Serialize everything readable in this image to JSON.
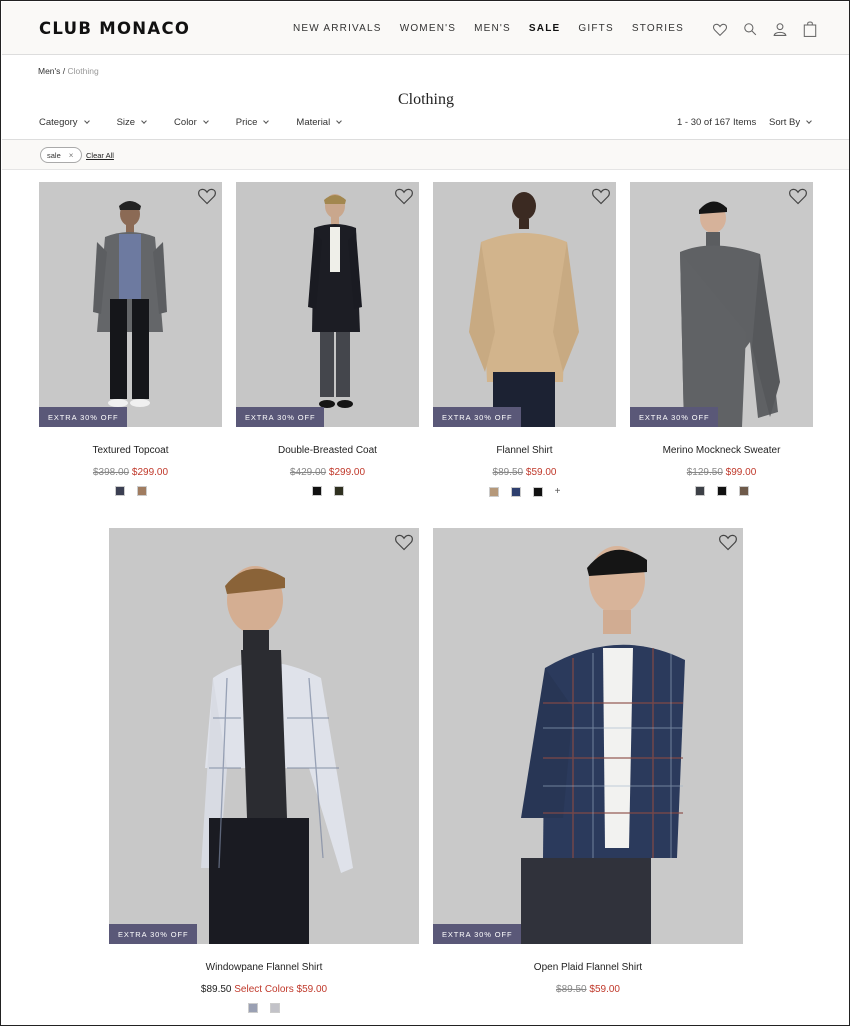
{
  "header": {
    "logo": "CLUB MONACO",
    "nav": [
      {
        "label": "NEW ARRIVALS",
        "name": "nav-new-arrivals"
      },
      {
        "label": "WOMEN'S",
        "name": "nav-womens"
      },
      {
        "label": "MEN'S",
        "name": "nav-mens"
      },
      {
        "label": "SALE",
        "name": "nav-sale"
      },
      {
        "label": "GIFTS",
        "name": "nav-gifts"
      },
      {
        "label": "STORIES",
        "name": "nav-stories"
      }
    ],
    "icons": [
      "heart-icon",
      "search-icon",
      "account-icon",
      "bag-icon"
    ]
  },
  "breadcrumb": {
    "parent": "Men's",
    "separator": " / ",
    "current": "Clothing"
  },
  "page_title": "Clothing",
  "filters": [
    "Category",
    "Size",
    "Color",
    "Price",
    "Material"
  ],
  "results_count": "1 - 30 of 167 Items",
  "sort_label": "Sort By",
  "active_filter": {
    "label": "sale",
    "remove": "×"
  },
  "clear_all": "Clear All",
  "colors": {
    "badge_bg": "#5a5878",
    "sale_price": "#c0392b",
    "header_bg": "#faf9f7"
  },
  "products": [
    {
      "name": "Textured Topcoat",
      "badge": "EXTRA 30% OFF",
      "original_price": "$398.00",
      "sale_price": "$299.00",
      "swatches": [
        "#3b3f52",
        "#a07c60"
      ]
    },
    {
      "name": "Double-Breasted Coat",
      "badge": "EXTRA 30% OFF",
      "original_price": "$429.00",
      "sale_price": "$299.00",
      "swatches": [
        "#111111",
        "#2f3020"
      ]
    },
    {
      "name": "Flannel Shirt",
      "badge": "EXTRA 30% OFF",
      "original_price": "$89.50",
      "sale_price": "$59.00",
      "swatches": [
        "#b5987a",
        "#2e3f6e",
        "#111111"
      ],
      "more": "+"
    },
    {
      "name": "Merino Mockneck Sweater",
      "badge": "EXTRA 30% OFF",
      "original_price": "$129.50",
      "sale_price": "$99.00",
      "swatches": [
        "#3d4047",
        "#111111",
        "#6e5a4a"
      ]
    },
    {
      "name": "Windowpane Flannel Shirt",
      "badge": "EXTRA 30% OFF",
      "regular_price": "$89.50",
      "sale_price": "Select Colors $59.00",
      "swatches": [
        "#9aa0b3",
        "#c2c2c8"
      ]
    },
    {
      "name": "Open Plaid Flannel Shirt",
      "badge": "EXTRA 30% OFF",
      "original_price": "$89.50",
      "sale_price": "$59.00",
      "swatches": []
    }
  ]
}
